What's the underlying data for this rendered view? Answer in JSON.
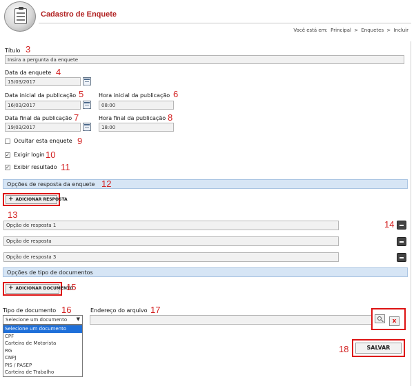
{
  "header": {
    "title": "Cadastro de Enquete",
    "breadcrumb_prefix": "Você está em:",
    "breadcrumb": [
      "Principal",
      "Enquetes",
      "Incluir"
    ],
    "breadcrumb_sep": ">"
  },
  "annotations": [
    "3",
    "4",
    "5",
    "6",
    "7",
    "8",
    "9",
    "10",
    "11",
    "12",
    "13",
    "14",
    "15",
    "16",
    "17",
    "18"
  ],
  "form": {
    "titulo_label": "Título",
    "titulo_placeholder": "Insira a pergunta da enquete",
    "data_enquete_label": "Data da enquete",
    "data_enquete_value": "15/03/2017",
    "data_inicial_label": "Data inicial da publicação",
    "data_inicial_value": "16/03/2017",
    "hora_inicial_label": "Hora inicial da publicação",
    "hora_inicial_value": "08:00",
    "data_final_label": "Data final da publicação",
    "data_final_value": "19/03/2017",
    "hora_final_label": "Hora final da publicação",
    "hora_final_value": "18:00",
    "ocultar_label": "Ocultar esta enquete",
    "ocultar_checked": false,
    "exigir_label": "Exigir login",
    "exigir_checked": true,
    "exibir_label": "Exibir resultado",
    "exibir_checked": true
  },
  "respostas": {
    "section_title": "Opções de resposta da enquete",
    "add_button": "ADICIONAR RESPOSTA",
    "options": [
      "Opção de resposta 1",
      "Opção de resposta",
      "Opção de resposta 3"
    ]
  },
  "documentos": {
    "section_title": "Opções de tipo de documentos",
    "add_button": "ADICIONAR DOCUMENTO",
    "tipo_label": "Tipo de documento",
    "tipo_selected": "Selecione um documento",
    "tipo_options": [
      "Selecione um documento",
      "CPF",
      "Carteira de Motorista",
      "RG",
      "CNPJ",
      "PIS / PASEP",
      "Carteira de Trabalho"
    ],
    "endereco_label": "Endereço do arquivo",
    "endereco_value": ""
  },
  "actions": {
    "save_label": "SALVAR"
  },
  "icons": {
    "logo": "clipboard-icon",
    "calendar": "calendar-icon",
    "remove": "minus-icon",
    "search": "magnifier-icon",
    "clear": "close-x-icon",
    "add": "plus-icon",
    "dropdown_arrow": "caret-down-icon"
  },
  "colors": {
    "title": "#b02020",
    "annotation": "#d32020",
    "section_bg": "#d6e5f5",
    "highlight": "#dd1111",
    "selected_option": "#1e6fd9"
  }
}
